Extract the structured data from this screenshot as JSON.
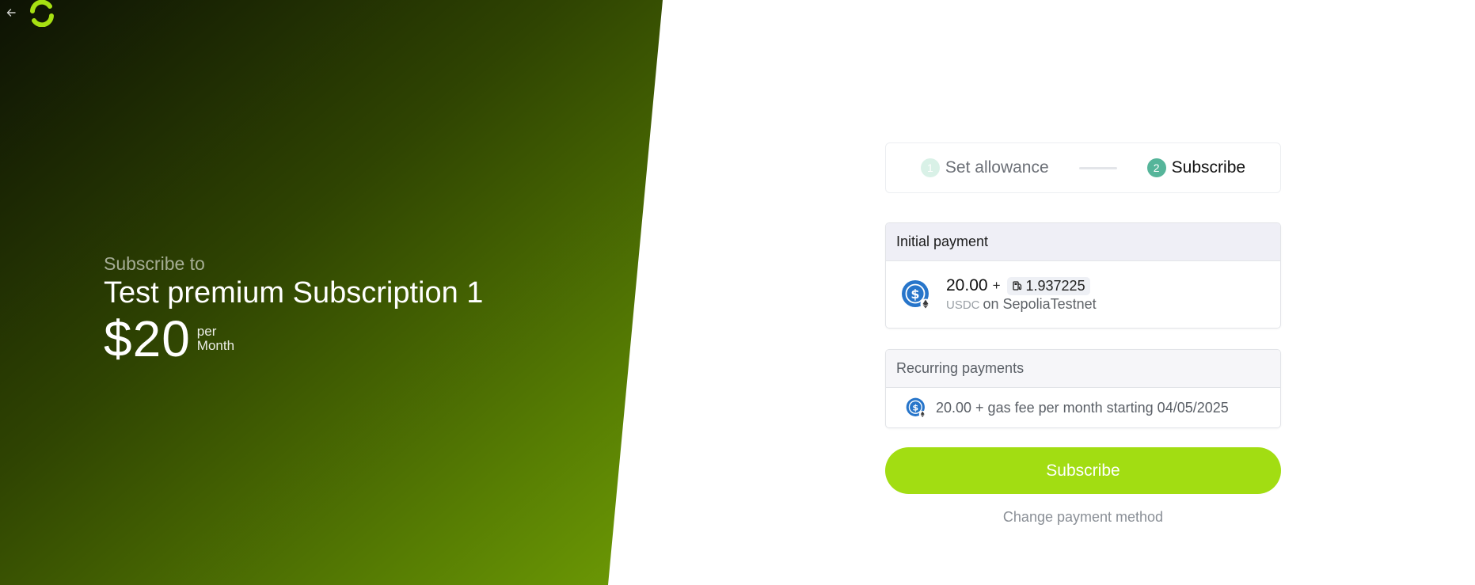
{
  "hero": {
    "subtitle": "Subscribe to",
    "title": "Test premium Subscription 1",
    "price": "$20",
    "period_top": "per",
    "period_bottom": "Month",
    "gradient_colors": [
      "#0d1204",
      "#2f4402",
      "#587f03",
      "#7fb107",
      "#9ddf07"
    ]
  },
  "nav": {
    "back_icon": "arrow-left-icon",
    "logo_icon": "logo-icon"
  },
  "steps": [
    {
      "number": "1",
      "label": "Set allowance",
      "state": "completed"
    },
    {
      "number": "2",
      "label": "Subscribe",
      "state": "active"
    }
  ],
  "initial_payment": {
    "header": "Initial payment",
    "amount": "20.00",
    "plus": "+",
    "gas_icon": "gas-pump-icon",
    "gas_fee": "1.937225",
    "token": "USDC",
    "network": "on SepoliaTestnet",
    "token_icon": "usdc-coin-icon"
  },
  "recurring_payments": {
    "header": "Recurring payments",
    "text": "20.00 + gas fee per month starting 04/05/2025"
  },
  "actions": {
    "subscribe_label": "Subscribe",
    "change_payment_label": "Change payment method"
  },
  "colors": {
    "accent": "#a2dd12",
    "step_active": "#56b59a",
    "step_done": "#d9f1e7",
    "usdc_blue": "#2775ca"
  }
}
